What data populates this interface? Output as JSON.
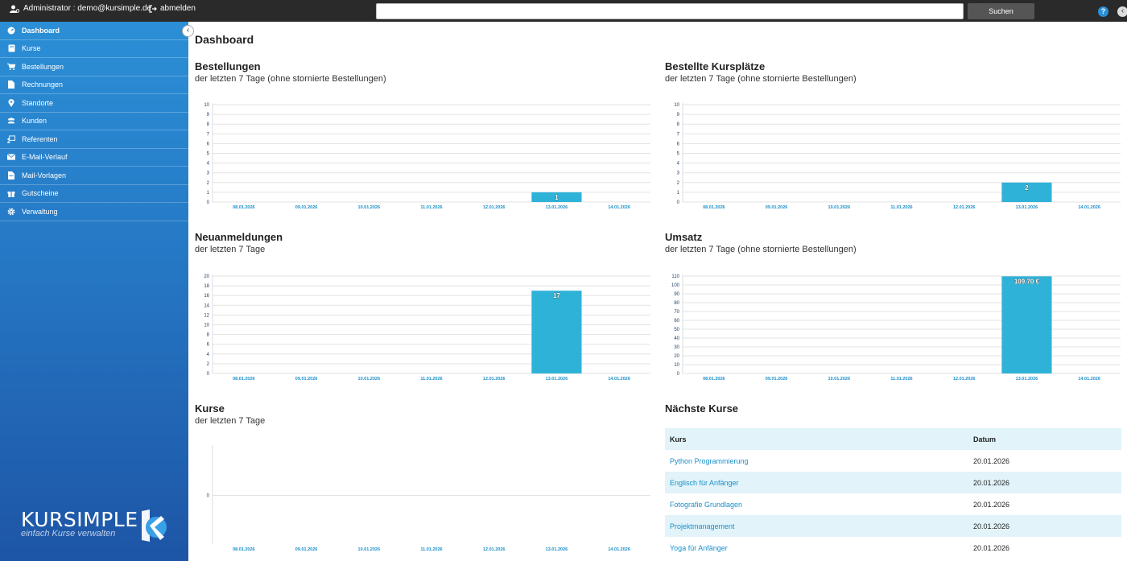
{
  "topbar": {
    "user": "Administrator : demo@kursimple.de",
    "logout": "abmelden",
    "search_placeholder": "",
    "search_button": "Suchen"
  },
  "sidebar": {
    "items": [
      {
        "label": "Dashboard",
        "icon": "dashboard-icon",
        "active": true
      },
      {
        "label": "Kurse",
        "icon": "book-icon"
      },
      {
        "label": "Bestellungen",
        "icon": "cart-icon"
      },
      {
        "label": "Rechnungen",
        "icon": "invoice-icon"
      },
      {
        "label": "Standorte",
        "icon": "map-pin-icon"
      },
      {
        "label": "Kunden",
        "icon": "users-icon"
      },
      {
        "label": "Referenten",
        "icon": "presenter-icon"
      },
      {
        "label": "E-Mail-Verlauf",
        "icon": "envelope-icon"
      },
      {
        "label": "Mail-Vorlagen",
        "icon": "template-icon"
      },
      {
        "label": "Gutscheine",
        "icon": "gift-icon"
      },
      {
        "label": "Verwaltung",
        "icon": "gear-icon"
      }
    ],
    "brand_name": "KURSIMPLE",
    "brand_tagline": "einfach Kurse verwalten"
  },
  "page_title": "Dashboard",
  "panels": {
    "bestellungen": {
      "title": "Bestellungen",
      "subtitle": "der letzten 7 Tage (ohne stornierte Bestellungen)"
    },
    "kursplaetze": {
      "title": "Bestellte Kursplätze",
      "subtitle": "der letzten 7 Tage (ohne stornierte Bestellungen)"
    },
    "neuanmeldungen": {
      "title": "Neuanmeldungen",
      "subtitle": "der letzten 7 Tage"
    },
    "umsatz": {
      "title": "Umsatz",
      "subtitle": "der letzten 7 Tage (ohne stornierte Bestellungen)"
    },
    "kurse": {
      "title": "Kurse",
      "subtitle": "der letzten 7 Tage"
    },
    "naechste": {
      "title": "Nächste Kurse"
    }
  },
  "colors": {
    "bar": "#2fb2d8",
    "axis_label": "#1a8fc9",
    "grid": "#e3e3e3"
  },
  "chart_data": [
    {
      "id": "bestellungen",
      "type": "bar",
      "categories": [
        "08.01.2026",
        "09.01.2026",
        "10.01.2026",
        "11.01.2026",
        "12.01.2026",
        "13.01.2026",
        "14.01.2026"
      ],
      "values": [
        0,
        0,
        0,
        0,
        0,
        1,
        0
      ],
      "value_labels": [
        "",
        "",
        "",
        "",
        "",
        "1",
        ""
      ],
      "yticks": [
        0,
        1,
        2,
        3,
        4,
        5,
        6,
        7,
        8,
        9,
        10
      ],
      "ylim": [
        0,
        10
      ]
    },
    {
      "id": "kursplaetze",
      "type": "bar",
      "categories": [
        "08.01.2026",
        "09.01.2026",
        "10.01.2026",
        "11.01.2026",
        "12.01.2026",
        "13.01.2026",
        "14.01.2026"
      ],
      "values": [
        0,
        0,
        0,
        0,
        0,
        2,
        0
      ],
      "value_labels": [
        "",
        "",
        "",
        "",
        "",
        "2",
        ""
      ],
      "yticks": [
        0,
        1,
        2,
        3,
        4,
        5,
        6,
        7,
        8,
        9,
        10
      ],
      "ylim": [
        0,
        10
      ]
    },
    {
      "id": "neuanmeldungen",
      "type": "bar",
      "categories": [
        "08.01.2026",
        "09.01.2026",
        "10.01.2026",
        "11.01.2026",
        "12.01.2026",
        "13.01.2026",
        "14.01.2026"
      ],
      "values": [
        0,
        0,
        0,
        0,
        0,
        17,
        0
      ],
      "value_labels": [
        "",
        "",
        "",
        "",
        "",
        "17",
        ""
      ],
      "yticks": [
        0,
        2,
        4,
        6,
        8,
        10,
        12,
        14,
        16,
        18,
        20
      ],
      "ylim": [
        0,
        20
      ]
    },
    {
      "id": "umsatz",
      "type": "bar",
      "categories": [
        "08.01.2026",
        "09.01.2026",
        "10.01.2026",
        "11.01.2026",
        "12.01.2026",
        "13.01.2026",
        "14.01.2026"
      ],
      "values": [
        0,
        0,
        0,
        0,
        0,
        109.7,
        0
      ],
      "value_labels": [
        "",
        "",
        "",
        "",
        "",
        "109.70 €",
        ""
      ],
      "yticks": [
        0,
        10,
        20,
        30,
        40,
        50,
        60,
        70,
        80,
        90,
        100,
        110
      ],
      "ylim": [
        0,
        110
      ]
    },
    {
      "id": "kurse",
      "type": "bar",
      "categories": [
        "08.01.2026",
        "09.01.2026",
        "10.01.2026",
        "11.01.2026",
        "12.01.2026",
        "13.01.2026",
        "14.01.2026"
      ],
      "values": [
        0,
        0,
        0,
        0,
        0,
        0,
        0
      ],
      "value_labels": [
        "",
        "",
        "",
        "",
        "",
        "",
        ""
      ],
      "yticks": [
        0
      ],
      "ylim": [
        -1,
        1
      ]
    }
  ],
  "table": {
    "headers": [
      "Kurs",
      "Datum"
    ],
    "rows": [
      {
        "kurs": "Python Programmierung",
        "datum": "20.01.2026"
      },
      {
        "kurs": "Englisch für Anfänger",
        "datum": "20.01.2026"
      },
      {
        "kurs": "Fotografie Grundlagen",
        "datum": "20.01.2026"
      },
      {
        "kurs": "Projektmanagement",
        "datum": "20.01.2026"
      },
      {
        "kurs": "Yoga für Anfänger",
        "datum": "20.01.2026"
      }
    ]
  }
}
